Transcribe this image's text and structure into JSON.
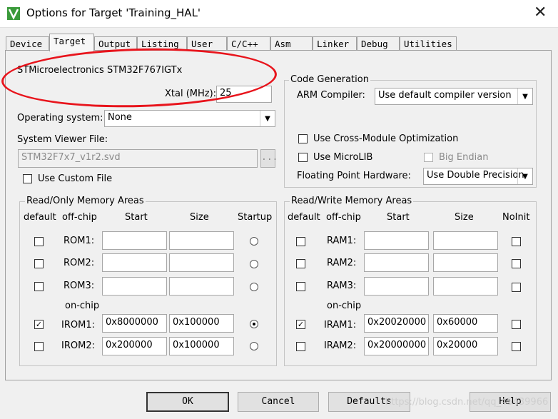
{
  "window": {
    "title": "Options for Target 'Training_HAL'",
    "close": "✕"
  },
  "tabs": [
    "Device",
    "Target",
    "Output",
    "Listing",
    "User",
    "C/C++",
    "Asm",
    "Linker",
    "Debug",
    "Utilities"
  ],
  "device": "STMicroelectronics STM32F767IGTx",
  "xtal": {
    "label": "Xtal (MHz):",
    "value": "25"
  },
  "os": {
    "label": "Operating system:",
    "value": "None"
  },
  "svd": {
    "label": "System Viewer File:",
    "value": "STM32F7x7_v1r2.svd",
    "browse": "..."
  },
  "custom_file": {
    "label": "Use Custom File",
    "checked": false
  },
  "codegen": {
    "legend": "Code Generation",
    "compiler_label": "ARM Compiler:",
    "compiler_value": "Use default compiler version",
    "cross_module": "Use Cross-Module Optimization",
    "microlib": "Use MicroLIB",
    "big_endian": "Big Endian",
    "fp_label": "Floating Point Hardware:",
    "fp_value": "Use Double Precision"
  },
  "ro": {
    "legend": "Read/Only Memory Areas",
    "headers": {
      "default": "default",
      "offchip": "off-chip",
      "start": "Start",
      "size": "Size",
      "startup": "Startup"
    },
    "onchip": "on-chip",
    "rows": [
      {
        "label": "ROM1:",
        "start": "",
        "size": "",
        "default": false,
        "startup": false
      },
      {
        "label": "ROM2:",
        "start": "",
        "size": "",
        "default": false,
        "startup": false
      },
      {
        "label": "ROM3:",
        "start": "",
        "size": "",
        "default": false,
        "startup": false
      },
      {
        "label": "IROM1:",
        "start": "0x8000000",
        "size": "0x100000",
        "default": true,
        "startup": true
      },
      {
        "label": "IROM2:",
        "start": "0x200000",
        "size": "0x100000",
        "default": false,
        "startup": false
      }
    ]
  },
  "rw": {
    "legend": "Read/Write Memory Areas",
    "headers": {
      "default": "default",
      "offchip": "off-chip",
      "start": "Start",
      "size": "Size",
      "noinit": "NoInit"
    },
    "onchip": "on-chip",
    "rows": [
      {
        "label": "RAM1:",
        "start": "",
        "size": "",
        "default": false,
        "noinit": false
      },
      {
        "label": "RAM2:",
        "start": "",
        "size": "",
        "default": false,
        "noinit": false
      },
      {
        "label": "RAM3:",
        "start": "",
        "size": "",
        "default": false,
        "noinit": false
      },
      {
        "label": "IRAM1:",
        "start": "0x20020000",
        "size": "0x60000",
        "default": true,
        "noinit": false
      },
      {
        "label": "IRAM2:",
        "start": "0x20000000",
        "size": "0x20000",
        "default": false,
        "noinit": false
      }
    ]
  },
  "buttons": {
    "ok": "OK",
    "cancel": "Cancel",
    "defaults": "Defaults",
    "help": "Help"
  },
  "watermark": "https://blog.csdn.net/qq_45439966",
  "colors": {
    "annotation": "#e8141c",
    "app_icon": "#3a9a3a"
  }
}
